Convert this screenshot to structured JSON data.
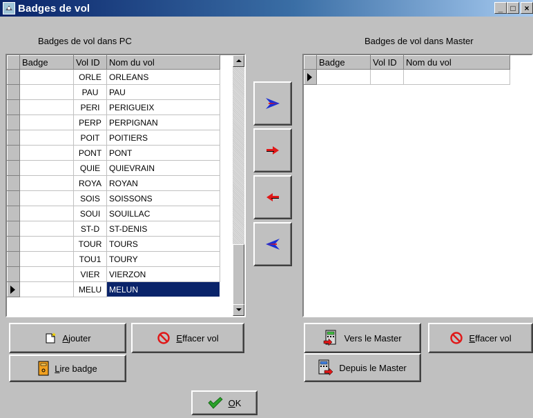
{
  "window": {
    "title": "Badges de vol",
    "minimize": "_",
    "maximize": "□",
    "close": "×"
  },
  "left_panel": {
    "header": "Badges de vol dans PC",
    "columns": [
      "Badge",
      "Vol ID",
      "Nom du vol"
    ],
    "rows": [
      {
        "badge": "",
        "vol_id": "ORLE",
        "nom": "ORLEANS"
      },
      {
        "badge": "",
        "vol_id": "PAU",
        "nom": "PAU"
      },
      {
        "badge": "",
        "vol_id": "PERI",
        "nom": "PERIGUEIX"
      },
      {
        "badge": "",
        "vol_id": "PERP",
        "nom": "PERPIGNAN"
      },
      {
        "badge": "",
        "vol_id": "POIT",
        "nom": "POITIERS"
      },
      {
        "badge": "",
        "vol_id": "PONT",
        "nom": "PONT"
      },
      {
        "badge": "",
        "vol_id": "QUIE",
        "nom": "QUIEVRAIN"
      },
      {
        "badge": "",
        "vol_id": "ROYA",
        "nom": "ROYAN"
      },
      {
        "badge": "",
        "vol_id": "SOIS",
        "nom": "SOISSONS"
      },
      {
        "badge": "",
        "vol_id": "SOUI",
        "nom": "SOUILLAC"
      },
      {
        "badge": "",
        "vol_id": "ST-D",
        "nom": "ST-DENIS"
      },
      {
        "badge": "",
        "vol_id": "TOUR",
        "nom": "TOURS"
      },
      {
        "badge": "",
        "vol_id": "TOU1",
        "nom": "TOURY"
      },
      {
        "badge": "",
        "vol_id": "VIER",
        "nom": "VIERZON"
      },
      {
        "badge": "",
        "vol_id": "MELU",
        "nom": "MELUN"
      }
    ],
    "selected_row": 14
  },
  "right_panel": {
    "header": "Badges de vol dans Master",
    "columns": [
      "Badge",
      "Vol ID",
      "Nom du vol"
    ]
  },
  "transfer_buttons": [
    "move-all-right",
    "move-one-right",
    "move-one-left",
    "move-all-left"
  ],
  "buttons": {
    "ajouter": {
      "pre": "",
      "u": "A",
      "post": "jouter"
    },
    "effacer_vol_left": {
      "pre": "",
      "u": "E",
      "post": "ffacer vol"
    },
    "lire_badge": {
      "pre": "",
      "u": "L",
      "post": "ire badge"
    },
    "vers_master": {
      "pre": "Vers le Master",
      "u": "",
      "post": ""
    },
    "effacer_vol_right": {
      "pre": "",
      "u": "E",
      "post": "ffacer vol"
    },
    "depuis_master": {
      "pre": "Depuis le Master",
      "u": "",
      "post": ""
    },
    "ok": {
      "pre": "",
      "u": "O",
      "post": "K"
    }
  },
  "colors": {
    "face": "#c0c0c0",
    "selection": "#0a246a",
    "arrow_blue": "#1a2fd6",
    "arrow_red": "#e01818"
  }
}
